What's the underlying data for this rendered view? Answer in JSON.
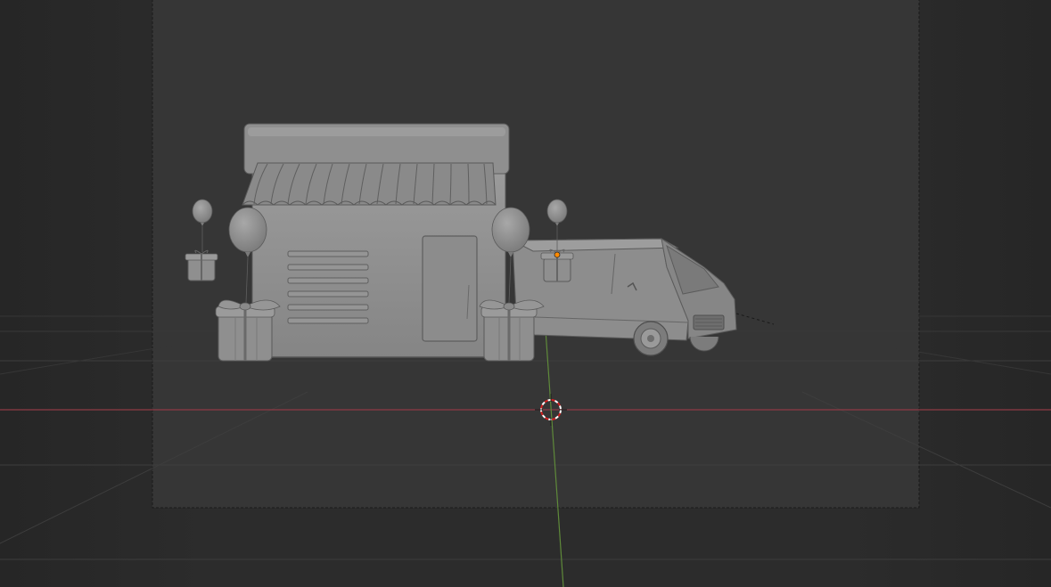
{
  "viewport": {
    "background": "#2b2b2b",
    "camera_frame_fill": "#353535",
    "grid_color": "#3a3a3a",
    "x_axis_color": "#8f3b45",
    "y_axis_color": "#5f8a3a",
    "mesh_color": "#8e8e8e",
    "mesh_shade": "#6f6f6f",
    "mesh_light": "#a3a3a3",
    "selected_origin_color": "#ff8a00"
  },
  "scene": {
    "objects": [
      "shop-building",
      "awning",
      "balloon",
      "gift-box",
      "delivery-van",
      "3d-cursor"
    ]
  }
}
